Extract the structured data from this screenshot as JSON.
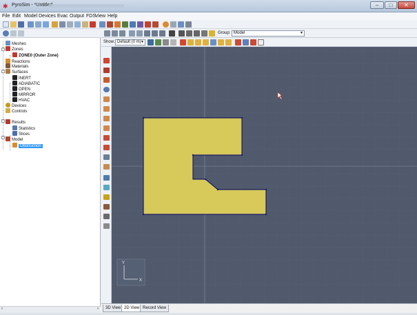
{
  "window": {
    "title": "PyroSim - *Untitled",
    "minimize_label": "–",
    "maximize_label": "□",
    "close_label": "✕"
  },
  "menu": [
    "File",
    "Edit",
    "Model",
    "Devices",
    "Evac",
    "Output",
    "FDS",
    "View",
    "Help"
  ],
  "tree": {
    "items": [
      {
        "label": "Meshes",
        "icon": "meshes-icon",
        "color": "#6a8fc9"
      },
      {
        "label": "Zones",
        "icon": "zones-icon",
        "color": "#c0392b"
      },
      {
        "label": "ZONE0 (Outer Zone)",
        "icon": "zone-icon",
        "color": "#c0392b"
      },
      {
        "label": "Reactions",
        "icon": "reactions-icon",
        "color": "#d98c2b"
      },
      {
        "label": "Materials",
        "icon": "materials-icon",
        "color": "#7d5a3c"
      },
      {
        "label": "Surfaces",
        "icon": "surfaces-icon",
        "color": "#b07a3a"
      },
      {
        "label": "INERT",
        "icon": "surface-icon",
        "color": "#222222"
      },
      {
        "label": "ADIABATIC",
        "icon": "surface-icon",
        "color": "#222222"
      },
      {
        "label": "OPEN",
        "icon": "surface-icon",
        "color": "#222222"
      },
      {
        "label": "MIRROR",
        "icon": "surface-icon",
        "color": "#222222"
      },
      {
        "label": "HVAC",
        "icon": "surface-icon",
        "color": "#222222"
      },
      {
        "label": "Devices",
        "icon": "devices-icon",
        "color": "#c59a1b"
      },
      {
        "label": "Controls",
        "icon": "controls-icon",
        "color": "#cfae4a"
      },
      {
        "label": "Results",
        "icon": "results-icon",
        "color": "#b1392e"
      },
      {
        "label": "Statistics",
        "icon": "statistics-icon",
        "color": "#5a7aa8"
      },
      {
        "label": "Slices",
        "icon": "slices-icon",
        "color": "#4c6fa8"
      },
      {
        "label": "Model",
        "icon": "model-icon",
        "color": "#b0462f"
      },
      {
        "label": "Obstruction",
        "icon": "obstruction-icon",
        "color": "#d98c2b",
        "selected": true
      }
    ]
  },
  "view_toolbar": {
    "show_label": "Show:",
    "show_value": "Default (0 m)",
    "group_label": "Group:",
    "group_value": "Model"
  },
  "tabs": [
    {
      "label": "3D View",
      "active": false
    },
    {
      "label": "2D View",
      "active": true
    },
    {
      "label": "Record View",
      "active": false
    }
  ],
  "axes": {
    "x_label": "X",
    "y_label": "Y"
  },
  "colors": {
    "canvas_bg": "#515a6d",
    "obstruction_fill": "#d7c95a",
    "selection_highlight": "#3399ff"
  }
}
